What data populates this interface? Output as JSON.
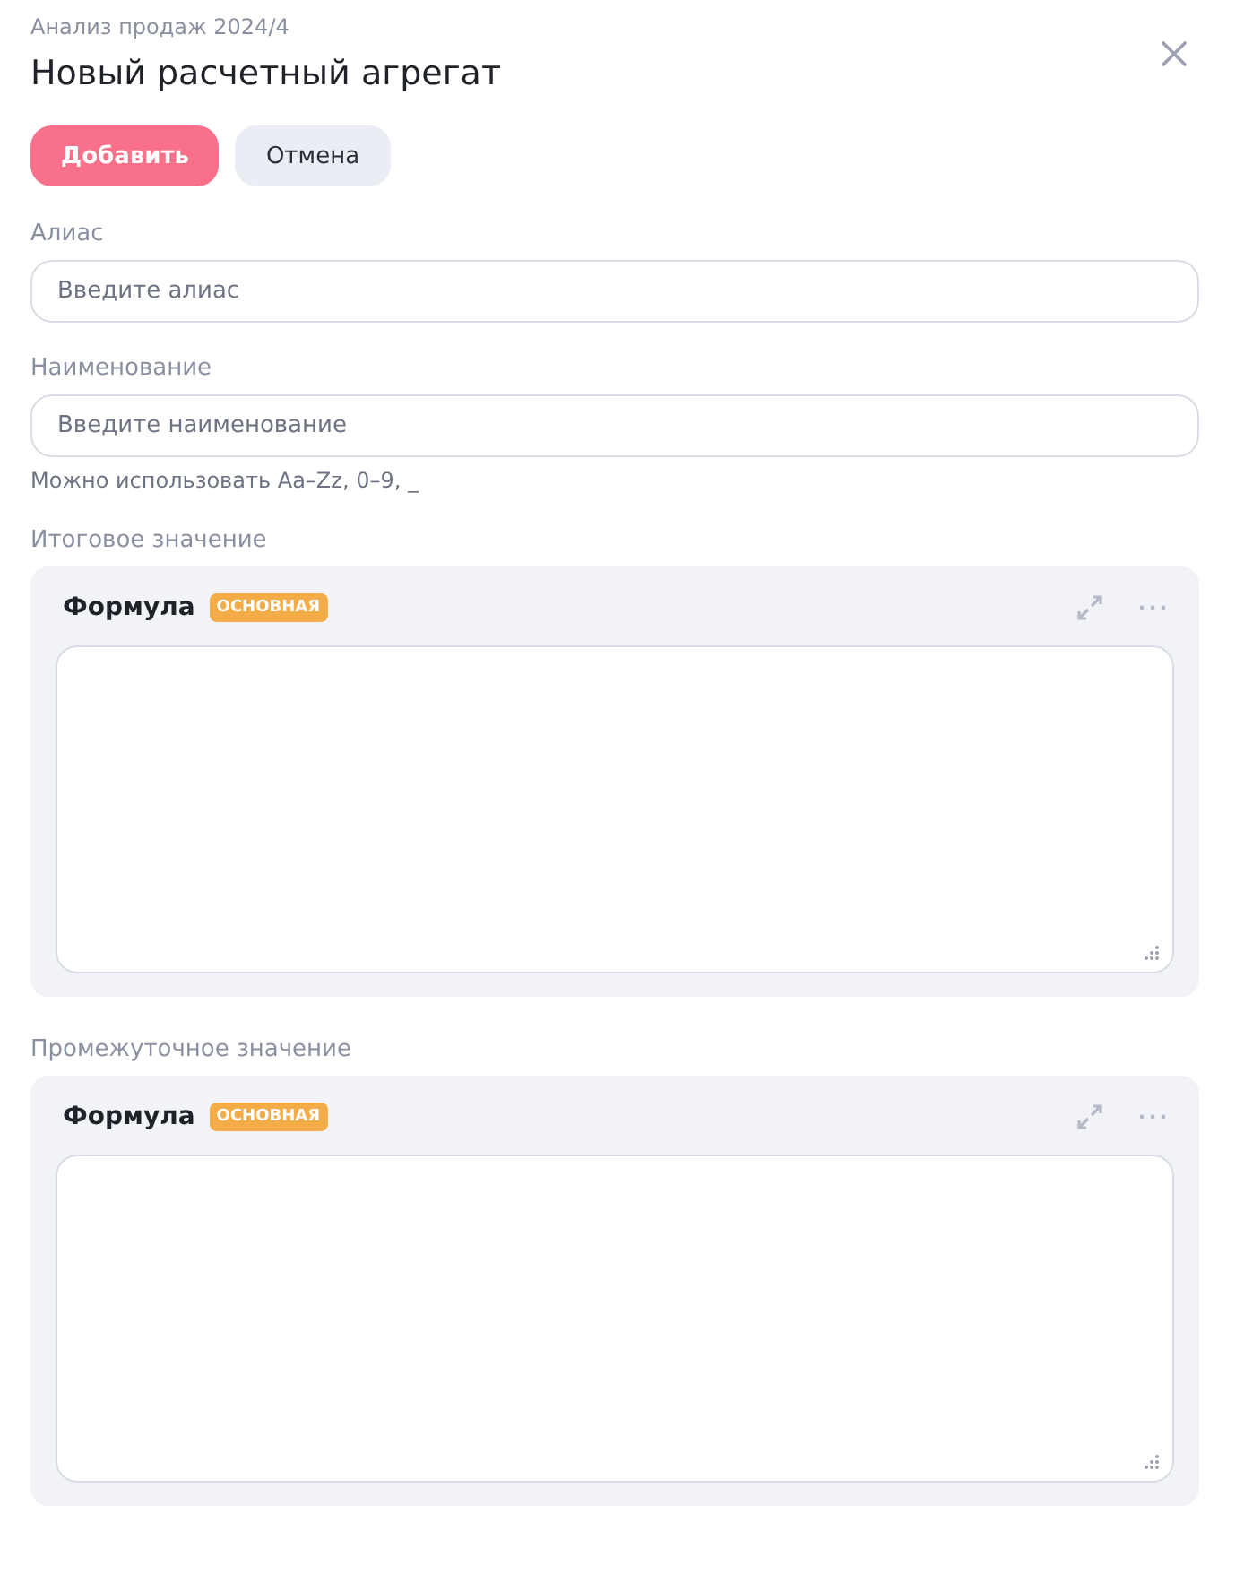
{
  "breadcrumb": "Анализ продаж 2024/4",
  "title": "Новый расчетный агрегат",
  "buttons": [
    {
      "label": "Добавить",
      "kind": "primary"
    },
    {
      "label": "Отмена",
      "kind": "secondary"
    }
  ],
  "fields": [
    {
      "label": "Алиас",
      "placeholder": "Введите алиас"
    },
    {
      "label": "Наименование",
      "placeholder": "Введите наименование",
      "hint": "Можно использовать Aa–Zz, 0–9, _"
    }
  ],
  "sections": [
    {
      "label": "Итоговое значение",
      "formula_title": "Формула",
      "badge": "ОСНОВНАЯ"
    },
    {
      "label": "Промежуточное значение",
      "formula_title": "Формула",
      "badge": "ОСНОВНАЯ"
    }
  ]
}
